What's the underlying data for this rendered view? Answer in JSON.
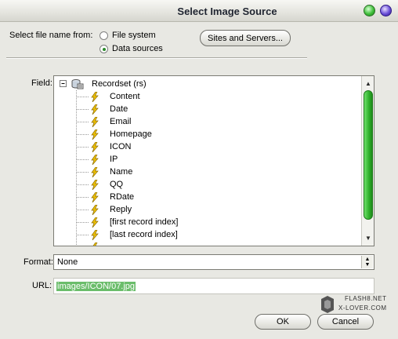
{
  "window": {
    "title": "Select Image Source"
  },
  "source": {
    "label": "Select file name from:",
    "options": [
      "File system",
      "Data sources"
    ],
    "selected": "Data sources",
    "sites_button": "Sites and Servers..."
  },
  "field": {
    "label": "Field:",
    "root": "Recordset (rs)",
    "items": [
      "Content",
      "Date",
      "Email",
      "Homepage",
      "ICON",
      "IP",
      "Name",
      "QQ",
      "RDate",
      "Reply",
      "[first record index]",
      "[last record index]"
    ]
  },
  "format": {
    "label": "Format:",
    "value": "None"
  },
  "url": {
    "label": "URL:",
    "value": "images/ICON/07.jpg"
  },
  "buttons": {
    "ok": "OK",
    "cancel": "Cancel"
  },
  "watermark": {
    "line1": "FLASH8.NET",
    "line2": "X-LOVER.COM"
  },
  "colors": {
    "accent_green": "#2fb02b",
    "selection": "#6bbd6b"
  }
}
